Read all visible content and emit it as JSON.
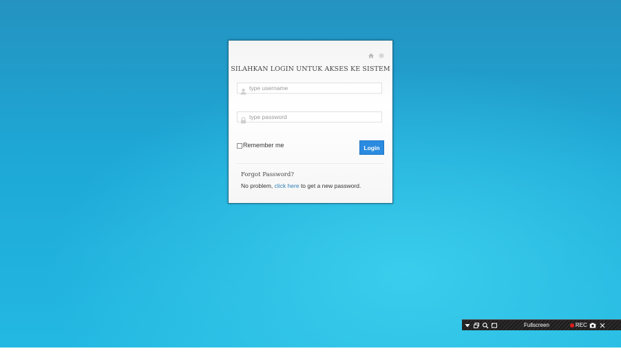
{
  "login": {
    "title": "SILAHKAN LOGIN UNTUK AKSES KE SISTEM",
    "username_placeholder": "type username",
    "password_placeholder": "type password",
    "remember_label": "Remember me",
    "login_button": "Login",
    "forgot_title": "Forgot Password?",
    "forgot_prefix": "No problem, ",
    "forgot_link": "click here",
    "forgot_suffix": " to get a new password.",
    "header_icons": [
      "home-icon",
      "gear-icon"
    ]
  },
  "toolbar": {
    "fullscreen_label": "Fullscreen",
    "rec_label": "REC",
    "icons": [
      "dropdown-icon",
      "windows-icon",
      "zoom-icon",
      "region-icon",
      "camera-icon",
      "close-icon"
    ]
  },
  "colors": {
    "background_top": "#2493c1",
    "background_bottom": "#23b9e2",
    "login_button": "#2a8be0",
    "link": "#2d7fb8",
    "rec_dot": "#e21b1b"
  }
}
